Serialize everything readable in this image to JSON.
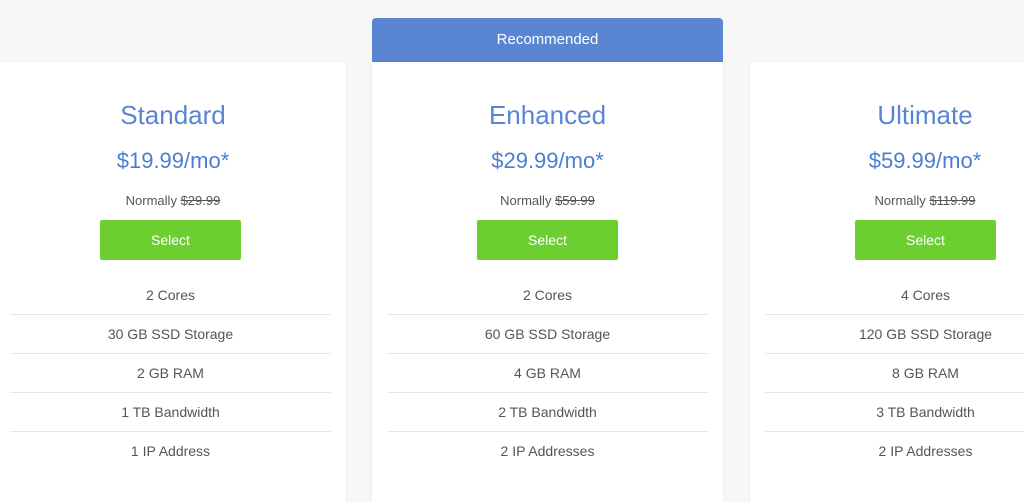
{
  "recommended_label": "Recommended",
  "plans": [
    {
      "name": "Standard",
      "price": "$19.99/mo*",
      "normally_label": "Normally",
      "normal_price": "$29.99",
      "select_label": "Select",
      "features": [
        "2 Cores",
        "30 GB SSD Storage",
        "2 GB RAM",
        "1 TB Bandwidth",
        "1 IP Address"
      ]
    },
    {
      "name": "Enhanced",
      "price": "$29.99/mo*",
      "normally_label": "Normally",
      "normal_price": "$59.99",
      "select_label": "Select",
      "features": [
        "2 Cores",
        "60 GB SSD Storage",
        "4 GB RAM",
        "2 TB Bandwidth",
        "2 IP Addresses"
      ]
    },
    {
      "name": "Ultimate",
      "price": "$59.99/mo*",
      "normally_label": "Normally",
      "normal_price": "$119.99",
      "select_label": "Select",
      "features": [
        "4 Cores",
        "120 GB SSD Storage",
        "8 GB RAM",
        "3 TB Bandwidth",
        "2 IP Addresses"
      ]
    }
  ],
  "colors": {
    "accent_blue": "#5985d2",
    "select_green": "#6ccf2f",
    "background": "#f7f7f7"
  }
}
